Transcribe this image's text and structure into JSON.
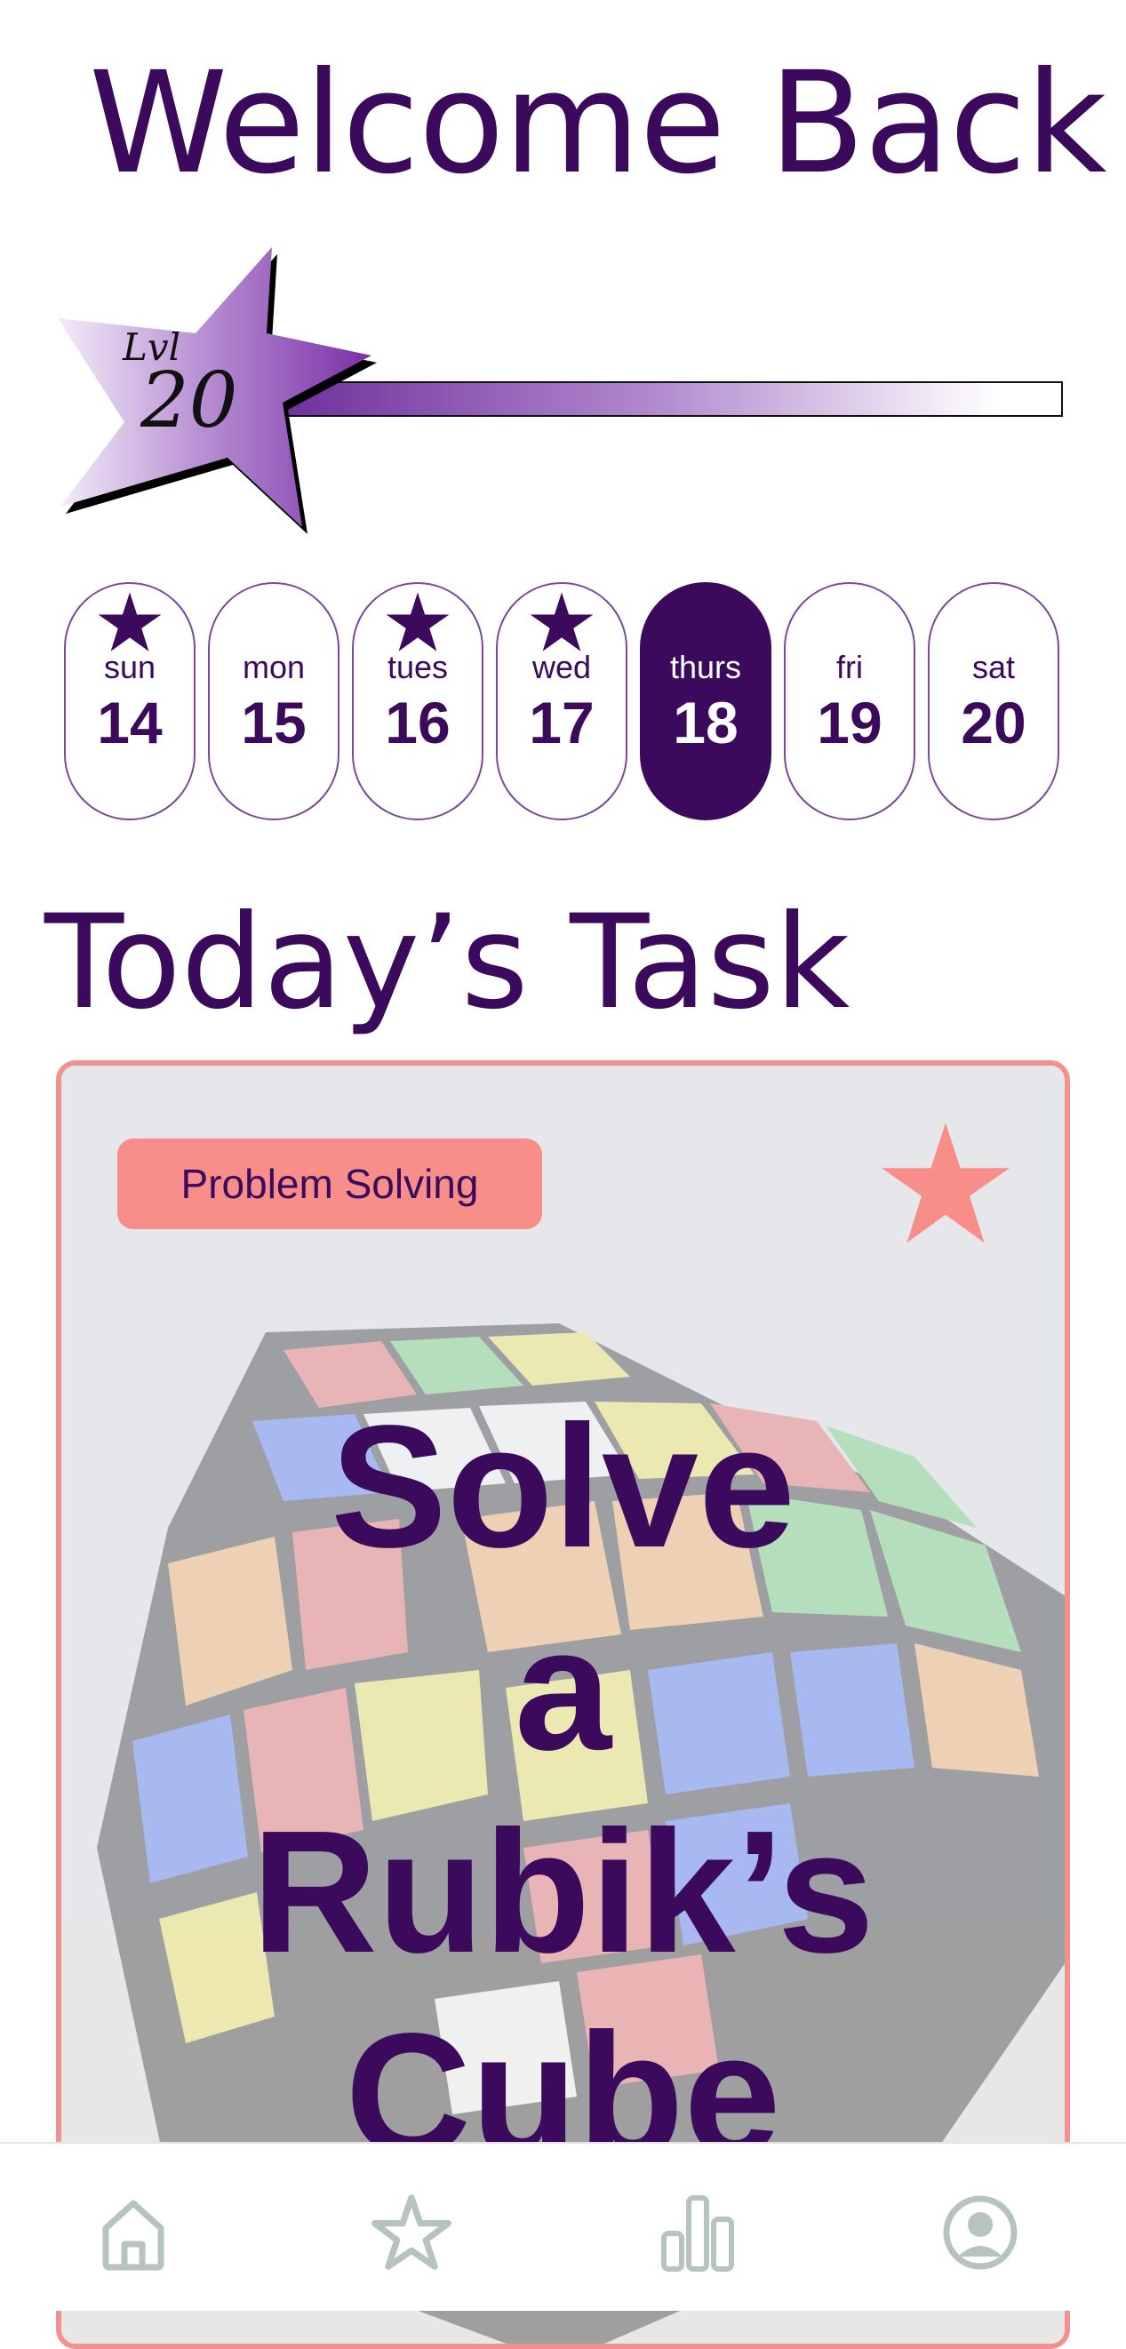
{
  "header": {
    "title": "Welcome Back"
  },
  "level": {
    "prefix": "Lvl",
    "number": "20",
    "progress": 0.92
  },
  "days": [
    {
      "name": "sun",
      "date": "14",
      "starred": true,
      "active": false
    },
    {
      "name": "mon",
      "date": "15",
      "starred": false,
      "active": false
    },
    {
      "name": "tues",
      "date": "16",
      "starred": true,
      "active": false
    },
    {
      "name": "wed",
      "date": "17",
      "starred": true,
      "active": false
    },
    {
      "name": "thurs",
      "date": "18",
      "starred": false,
      "active": true
    },
    {
      "name": "fri",
      "date": "19",
      "starred": false,
      "active": false
    },
    {
      "name": "sat",
      "date": "20",
      "starred": false,
      "active": false
    }
  ],
  "today": {
    "heading": "Today’s Task",
    "category": "Problem Solving",
    "task_lines": [
      "Solve",
      "a",
      "Rubik’s",
      "Cube"
    ]
  },
  "nav": {
    "items": [
      {
        "icon": "home-icon"
      },
      {
        "icon": "star-icon"
      },
      {
        "icon": "bar-chart-icon"
      },
      {
        "icon": "profile-icon"
      }
    ]
  },
  "colors": {
    "primary": "#3b0a5c",
    "accent": "#f88e8a",
    "nav_icon": "#b7c4be",
    "card_bg": "#e6e7ea"
  }
}
